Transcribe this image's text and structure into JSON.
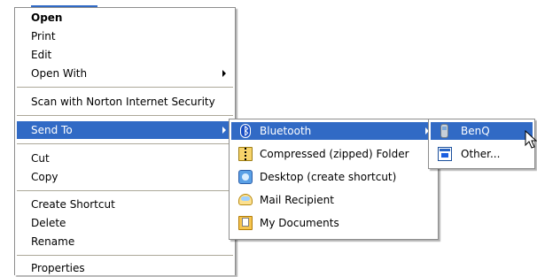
{
  "main_menu": {
    "items": [
      {
        "label": "Open",
        "bold": true
      },
      {
        "label": "Print"
      },
      {
        "label": "Edit"
      },
      {
        "label": "Open With",
        "submenu": true
      },
      {
        "label": "Scan with Norton Internet Security"
      },
      {
        "label": "Send To",
        "submenu": true,
        "highlighted": true
      },
      {
        "label": "Cut"
      },
      {
        "label": "Copy"
      },
      {
        "label": "Create Shortcut"
      },
      {
        "label": "Delete"
      },
      {
        "label": "Rename"
      },
      {
        "label": "Properties"
      }
    ]
  },
  "send_to_menu": {
    "items": [
      {
        "label": "Bluetooth",
        "icon": "bluetooth-icon",
        "submenu": true,
        "highlighted": true
      },
      {
        "label": "Compressed (zipped) Folder",
        "icon": "zip-folder-icon"
      },
      {
        "label": "Desktop (create shortcut)",
        "icon": "desktop-icon"
      },
      {
        "label": "Mail Recipient",
        "icon": "mail-icon"
      },
      {
        "label": "My Documents",
        "icon": "documents-folder-icon"
      }
    ]
  },
  "bluetooth_menu": {
    "items": [
      {
        "label": "BenQ",
        "icon": "phone-icon",
        "highlighted": true
      },
      {
        "label": "Other...",
        "icon": "device-icon"
      }
    ]
  },
  "colors": {
    "highlight": "#316ac5",
    "menu_background": "#ffffff",
    "separator": "#aca899",
    "border": "#8d8d8d"
  }
}
